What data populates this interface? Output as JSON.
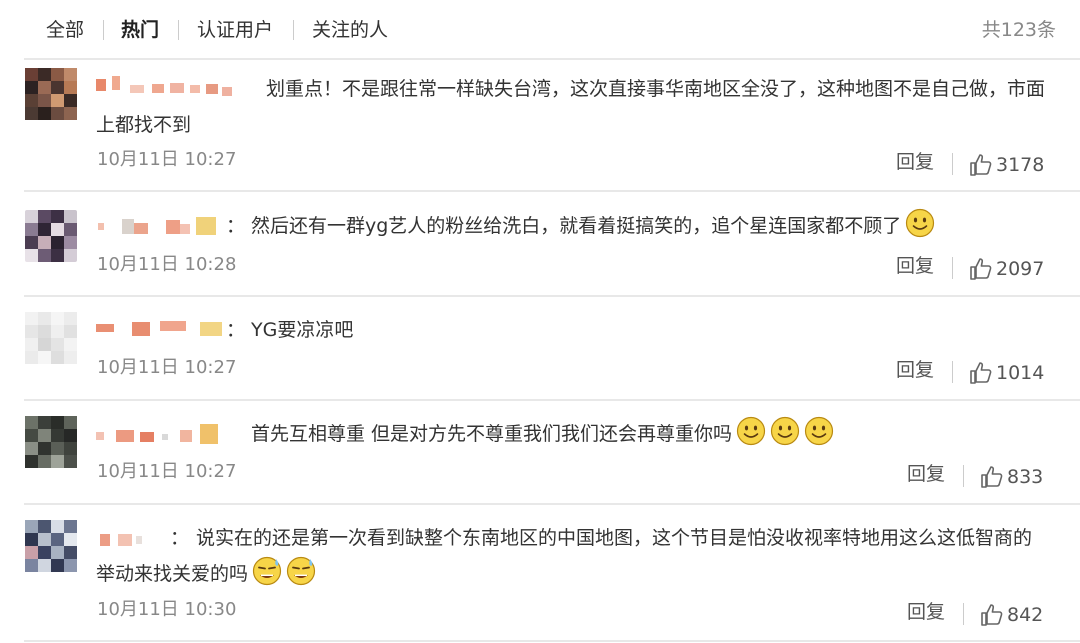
{
  "tabs": [
    {
      "label": "全部"
    },
    {
      "label": "热门"
    },
    {
      "label": "认证用户"
    },
    {
      "label": "关注的人"
    }
  ],
  "total": "共123条",
  "reply_label": "回复",
  "comments": [
    {
      "text": "划重点！不是跟往常一样缺失台湾，这次直接事华南地区全没了，这种地图不是自己做，市面上都找不到",
      "time": "10月11日 10:27",
      "likes": "3178"
    },
    {
      "colon": "：",
      "text": "然后还有一群yg艺人的粉丝给洗白，就看着挺搞笑的，追个星连国家都不顾了",
      "emojis": [
        "smile-emoji"
      ],
      "time": "10月11日 10:28",
      "likes": "2097"
    },
    {
      "colon": "：",
      "text": "YG要凉凉吧",
      "time": "10月11日 10:27",
      "likes": "1014"
    },
    {
      "text": "首先互相尊重 但是对方先不尊重我们我们还会再尊重你吗",
      "emojis": [
        "smile-emoji",
        "smile-emoji",
        "smile-emoji"
      ],
      "time": "10月11日 10:27",
      "likes": "833"
    },
    {
      "colon": "：",
      "text": "说实在的还是第一次看到缺整个东南地区的中国地图，这个节目是怕没收视率特地用这么这低智商的举动来找关爱的吗",
      "emojis": [
        "awkward-sweat-emoji",
        "awkward-sweat-emoji"
      ],
      "time": "10月11日 10:30",
      "likes": "842"
    }
  ]
}
